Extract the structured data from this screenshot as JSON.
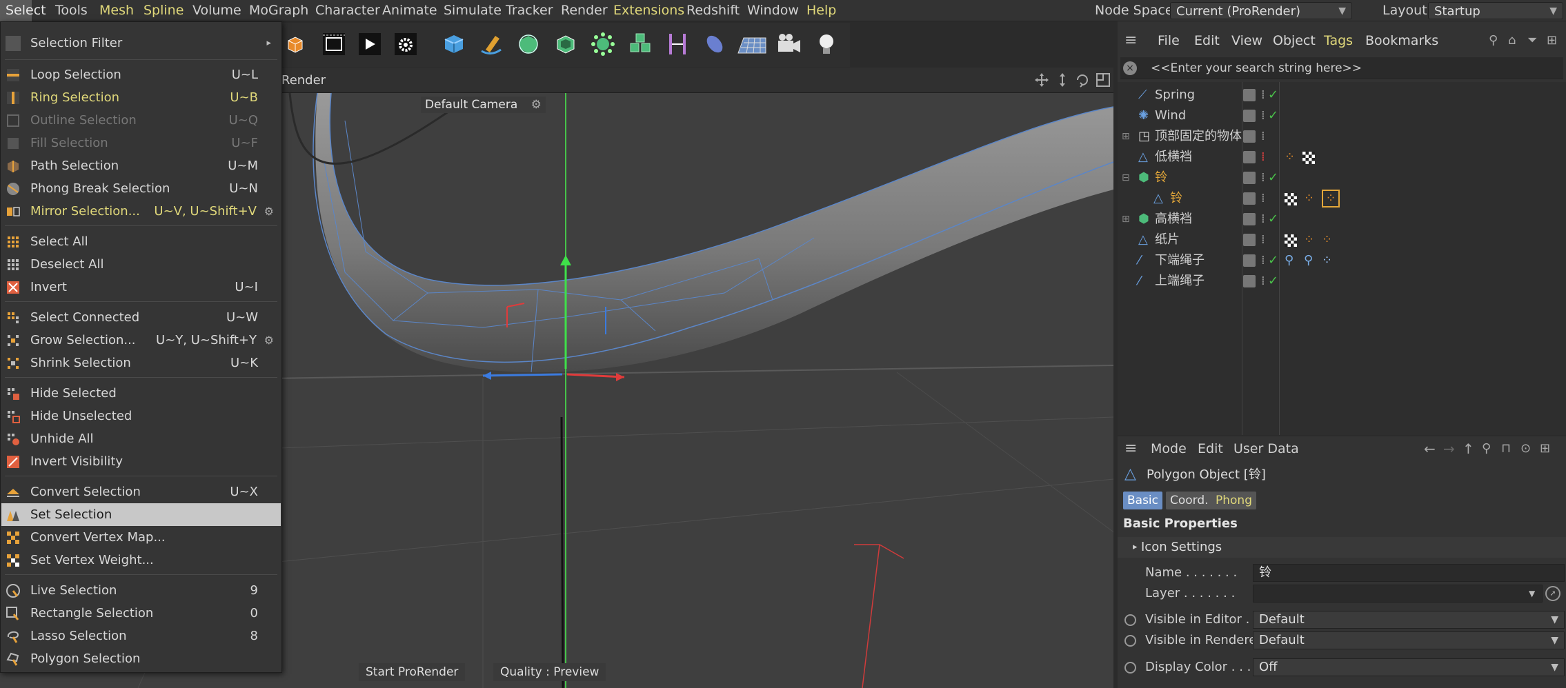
{
  "menubar": {
    "items": [
      "Select",
      "Tools",
      "Mesh",
      "Spline",
      "Volume",
      "MoGraph",
      "Character",
      "Animate",
      "Simulate",
      "Tracker",
      "Render",
      "Extensions",
      "Redshift",
      "Window",
      "Help"
    ],
    "node_space_label": "Node Space:",
    "node_space_value": "Current (ProRender)",
    "layout_label": "Layout:",
    "layout_value": "Startup"
  },
  "viewport": {
    "render_label": "Render",
    "camera_label": "Default Camera",
    "start_prorender": "Start ProRender",
    "quality": "Quality : Preview"
  },
  "select_menu": {
    "items": [
      {
        "label": "Selection Filter",
        "shortcut": ""
      },
      {
        "label": "Loop Selection",
        "shortcut": "U~L"
      },
      {
        "label": "Ring Selection",
        "shortcut": "U~B"
      },
      {
        "label": "Outline Selection",
        "shortcut": "U~Q"
      },
      {
        "label": "Fill Selection",
        "shortcut": "U~F"
      },
      {
        "label": "Path Selection",
        "shortcut": "U~M"
      },
      {
        "label": "Phong Break Selection",
        "shortcut": "U~N"
      },
      {
        "label": "Mirror Selection...",
        "shortcut": "U~V, U~Shift+V"
      },
      {
        "label": "Select All",
        "shortcut": ""
      },
      {
        "label": "Deselect All",
        "shortcut": ""
      },
      {
        "label": "Invert",
        "shortcut": "U~I"
      },
      {
        "label": "Select Connected",
        "shortcut": "U~W"
      },
      {
        "label": "Grow Selection...",
        "shortcut": "U~Y, U~Shift+Y"
      },
      {
        "label": "Shrink Selection",
        "shortcut": "U~K"
      },
      {
        "label": "Hide Selected",
        "shortcut": ""
      },
      {
        "label": "Hide Unselected",
        "shortcut": ""
      },
      {
        "label": "Unhide All",
        "shortcut": ""
      },
      {
        "label": "Invert Visibility",
        "shortcut": ""
      },
      {
        "label": "Convert Selection",
        "shortcut": "U~X"
      },
      {
        "label": "Set Selection",
        "shortcut": ""
      },
      {
        "label": "Convert Vertex Map...",
        "shortcut": ""
      },
      {
        "label": "Set Vertex Weight...",
        "shortcut": ""
      },
      {
        "label": "Live Selection",
        "shortcut": "9"
      },
      {
        "label": "Rectangle Selection",
        "shortcut": "0"
      },
      {
        "label": "Lasso Selection",
        "shortcut": "8"
      },
      {
        "label": "Polygon Selection",
        "shortcut": ""
      }
    ]
  },
  "object_manager": {
    "menu": [
      "File",
      "Edit",
      "View",
      "Object",
      "Tags",
      "Bookmarks"
    ],
    "search_placeholder": "<<Enter your search string here>>",
    "objects": [
      {
        "name": "Spring"
      },
      {
        "name": "Wind"
      },
      {
        "name": "顶部固定的物体"
      },
      {
        "name": "低横裆"
      },
      {
        "name": "铃"
      },
      {
        "name": "铃"
      },
      {
        "name": "高横裆"
      },
      {
        "name": "纸片"
      },
      {
        "name": "下端绳子"
      },
      {
        "name": "上端绳子"
      }
    ]
  },
  "attribute_manager": {
    "menu": [
      "Mode",
      "Edit",
      "User Data"
    ],
    "object_title": "Polygon Object [铃]",
    "tabs": [
      "Basic",
      "Coord.",
      "Phong"
    ],
    "section": "Basic Properties",
    "icon_settings": "Icon Settings",
    "name_label": "Name . . . . . . .",
    "name_value": "铃",
    "layer_label": "Layer . . . . . . .",
    "layer_value": "",
    "vis_editor_label": "Visible in Editor .",
    "vis_editor_value": "Default",
    "vis_renderer_label": "Visible in Renderer",
    "vis_renderer_value": "Default",
    "display_color_label": "Display Color . . .",
    "display_color_value": "Off"
  },
  "colors": {
    "accent_yellow": "#e0d87a",
    "selected_orange": "#e3a73a",
    "tab_active": "#6a8ec4"
  }
}
